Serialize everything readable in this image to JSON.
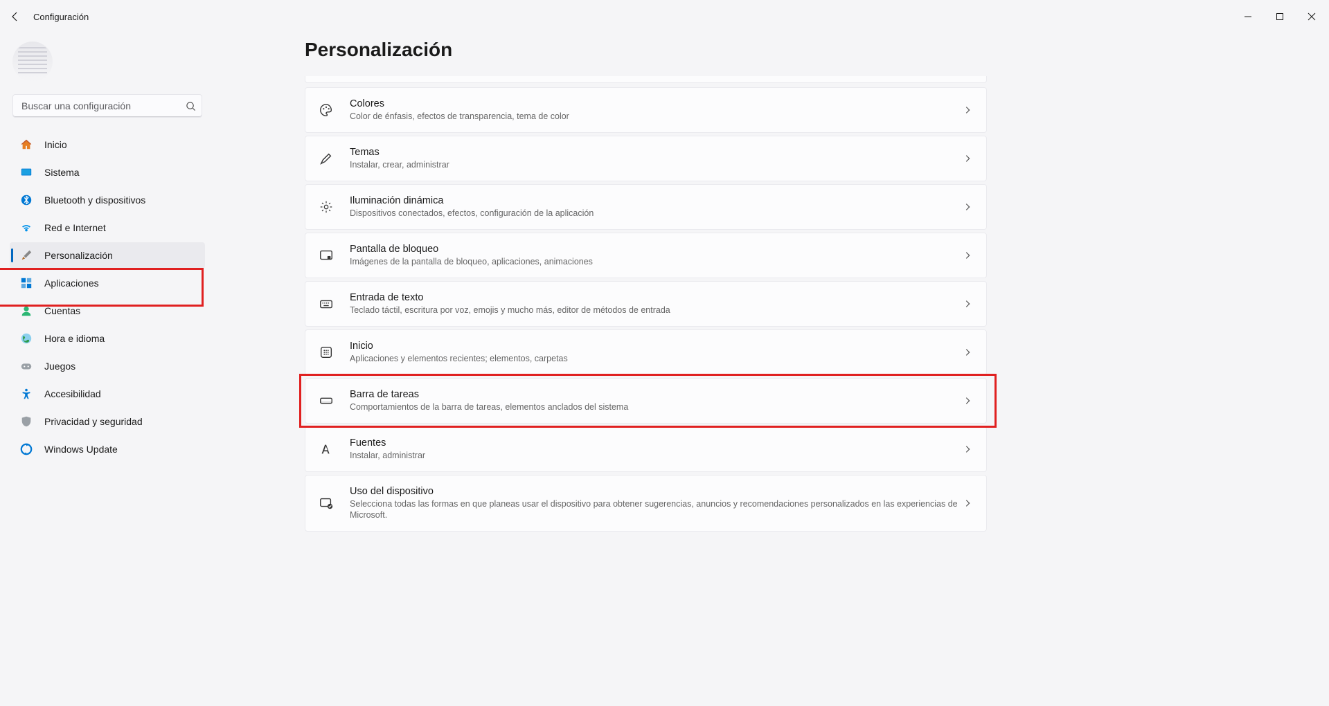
{
  "window": {
    "title": "Configuración"
  },
  "search": {
    "placeholder": "Buscar una configuración"
  },
  "nav": [
    {
      "id": "home",
      "label": "Inicio"
    },
    {
      "id": "system",
      "label": "Sistema"
    },
    {
      "id": "bt",
      "label": "Bluetooth y dispositivos"
    },
    {
      "id": "net",
      "label": "Red e Internet"
    },
    {
      "id": "perso",
      "label": "Personalización"
    },
    {
      "id": "apps",
      "label": "Aplicaciones"
    },
    {
      "id": "acct",
      "label": "Cuentas"
    },
    {
      "id": "time",
      "label": "Hora e idioma"
    },
    {
      "id": "games",
      "label": "Juegos"
    },
    {
      "id": "a11y",
      "label": "Accesibilidad"
    },
    {
      "id": "priv",
      "label": "Privacidad y seguridad"
    },
    {
      "id": "wu",
      "label": "Windows Update"
    }
  ],
  "page": {
    "title": "Personalización",
    "items": [
      {
        "id": "colors",
        "title": "Colores",
        "sub": "Color de énfasis, efectos de transparencia, tema de color"
      },
      {
        "id": "themes",
        "title": "Temas",
        "sub": "Instalar, crear, administrar"
      },
      {
        "id": "dynlight",
        "title": "Iluminación dinámica",
        "sub": "Dispositivos conectados, efectos, configuración de la aplicación"
      },
      {
        "id": "lock",
        "title": "Pantalla de bloqueo",
        "sub": "Imágenes de la pantalla de bloqueo, aplicaciones, animaciones"
      },
      {
        "id": "text",
        "title": "Entrada de texto",
        "sub": "Teclado táctil, escritura por voz, emojis y mucho más, editor de métodos de entrada"
      },
      {
        "id": "start",
        "title": "Inicio",
        "sub": "Aplicaciones y elementos recientes; elementos, carpetas"
      },
      {
        "id": "taskbar",
        "title": "Barra de tareas",
        "sub": "Comportamientos de la barra de tareas, elementos anclados del sistema"
      },
      {
        "id": "fonts",
        "title": "Fuentes",
        "sub": "Instalar, administrar"
      },
      {
        "id": "usage",
        "title": "Uso del dispositivo",
        "sub": "Selecciona todas las formas en que planeas usar el dispositivo para obtener sugerencias, anuncios y recomendaciones personalizados en las experiencias de Microsoft."
      }
    ]
  },
  "highlights": {
    "nav_item": "perso",
    "card": "taskbar"
  }
}
